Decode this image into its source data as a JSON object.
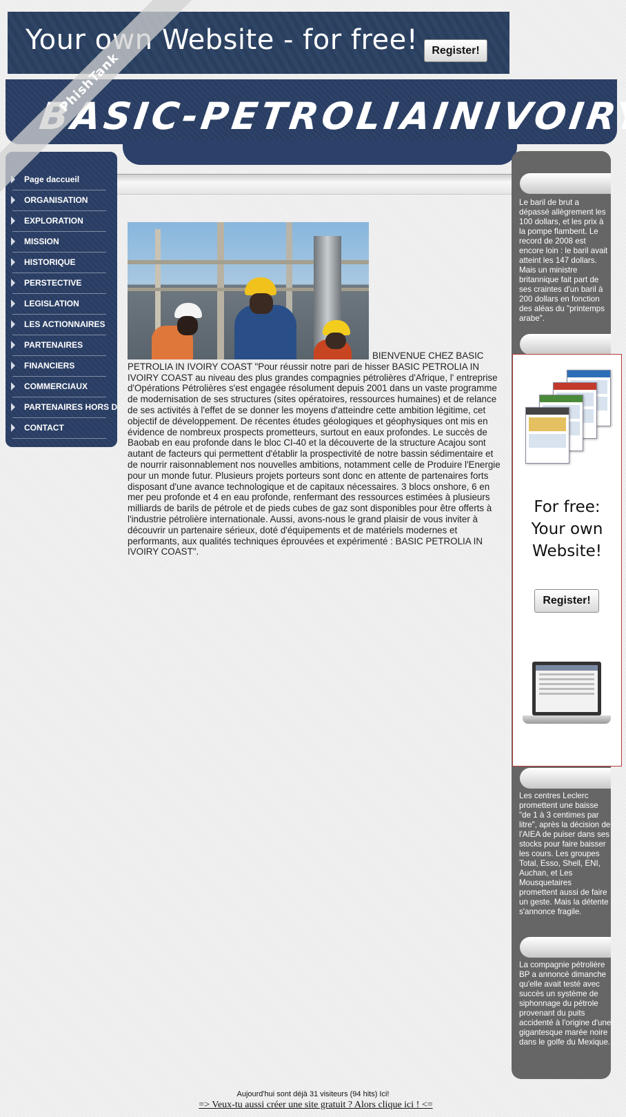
{
  "top_ad": {
    "headline": "Your own Website - for free!",
    "register_label": "Register!"
  },
  "header": {
    "site_title": "BASIC-PETROLIAINIVOIRY"
  },
  "watermark": "PhishTank",
  "nav": {
    "items": [
      {
        "label": "Page daccueil"
      },
      {
        "label": "ORGANISATION"
      },
      {
        "label": "EXPLORATION"
      },
      {
        "label": "MISSION"
      },
      {
        "label": "HISTORIQUE"
      },
      {
        "label": "PERSTECTIVE"
      },
      {
        "label": "LEGISLATION"
      },
      {
        "label": "LES ACTIONNAIRES"
      },
      {
        "label": "PARTENAIRES"
      },
      {
        "label": "FINANCIERS"
      },
      {
        "label": "COMMERCIAUX"
      },
      {
        "label": "PARTENAIRES HORS D"
      },
      {
        "label": "CONTACT"
      }
    ]
  },
  "main": {
    "article": "BIENVENUE CHEZ BASIC PETROLIA IN IVOIRY COAST \"Pour réussir notre pari de hisser BASIC PETROLIA IN IVOIRY COAST au niveau des plus grandes compagnies pétrolières d'Afrique, l' entreprise d'Opérations Pétrolières s'est engagée résolument depuis 2001 dans un vaste programme de modernisation de ses structures (sites opératoires, ressources humaines) et de relance de ses activités à l'effet de se donner les moyens d'atteindre cette ambition légitime, cet objectif de développement. De récentes études géologiques et géophysiques ont mis en évidence de nombreux prospects prometteurs, surtout en eaux profondes. Le succès de Baobab en eau profonde dans le bloc CI-40 et la découverte de la structure Acajou sont autant de facteurs qui permettent d'établir la prospectivité de notre bassin sédimentaire et de nourrir raisonnablement nos nouvelles ambitions, notamment celle de Produire l'Energie pour un monde futur. Plusieurs projets porteurs sont donc en attente de partenaires forts disposant d'une avance technologique et de capitaux nécessaires. 3 blocs onshore, 6 en mer peu profonde et 4 en eau profonde, renfermant des ressources estimées à plusieurs milliards de barils de pétrole et de pieds cubes de gaz sont disponibles pour être offerts à l'industrie pétrolière internationale. Aussi, avons-nous le grand plaisir de vous inviter à découvrir un partenaire sérieux, doté d'équipements et de matériels modernes et performants, aux qualités techniques éprouvées et expérimenté : BASIC PETROLIA IN IVOIRY COAST\"."
  },
  "right": {
    "news1": "Le baril de brut a dépassé allègrement les 100 dollars, et les prix à la pompe flambent. Le record de 2008 est encore loin : le baril avait atteint les 147 dollars. Mais un ministre britannique fait part de ses craintes d'un baril à 200 dollars en fonction des aléas du \"printemps arabe\".",
    "news2": "Les centres Leclerc promettent une baisse \"de 1 à 3 centimes par litre\", après la décision de l'AIEA de puiser dans ses stocks pour faire baisser les cours. Les groupes Total, Esso, Shell, ENI, Auchan, et Les Mousquetaires promettent aussi de faire un geste. Mais la détente s'annonce fragile.",
    "news3": "La compagnie pétrolière BP a annoncé dimanche qu'elle avait testé avec succès un système de siphonnage du pétrole provenant du puits accidenté à l'origine d'une gigantesque marée noire dans le golfe du Mexique."
  },
  "side_ad": {
    "line1": "For free:",
    "line2": "Your own",
    "line3": "Website!",
    "register_label": "Register!"
  },
  "footer": {
    "visitors": "Aujourd'hui sont déjà 31 visiteurs (94 hits) Ici!",
    "link": "=> Veux-tu aussi créer une site gratuit ? Alors clique ici ! <="
  },
  "colors": {
    "header_navy": "#2c406a",
    "right_column_gray": "#666666",
    "side_ad_border": "#b23a3a"
  }
}
